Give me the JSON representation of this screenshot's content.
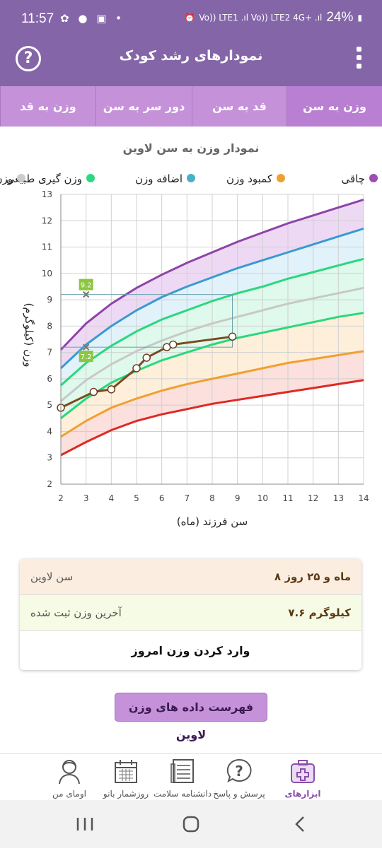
{
  "status": {
    "time": "11:57",
    "left_icons": "✿ ● ▣ •",
    "network": "Vo)) LTE1 .ıl Vo)) LTE2 4G+ .ıl",
    "battery": "24%"
  },
  "app_bar": {
    "title": "نمودارهای رشد کودک",
    "help_icon": "?"
  },
  "tabs": [
    "وزن به سن",
    "قد به سن",
    "دور سر به سن",
    "وزن به قد"
  ],
  "chart_data": {
    "type": "line",
    "title": "نمودار وزن به سن لاوین",
    "xlabel": "سن فرزند (ماه)",
    "ylabel": "وزن (کیلوگرم)",
    "xlim": [
      2,
      14
    ],
    "ylim": [
      2,
      13
    ],
    "x_ticks": [
      2,
      3,
      4,
      5,
      6,
      7,
      8,
      9,
      10,
      11,
      12,
      13,
      14
    ],
    "y_ticks": [
      2,
      3,
      4,
      5,
      6,
      7,
      8,
      9,
      10,
      11,
      12,
      13
    ],
    "legend": [
      "چاقی",
      "کمبود وزن",
      "اضافه وزن",
      "وزن گیری طبیعی",
      "وزن میانگین"
    ],
    "legend_colors": [
      "#9c4fb0",
      "#f0a030",
      "#4ab0c8",
      "#2ed880",
      "#cccccc"
    ],
    "curves": [
      {
        "color": "#8e44a8",
        "x": [
          2,
          3,
          4,
          5,
          6,
          7,
          8,
          9,
          10,
          11,
          12,
          13,
          14
        ],
        "y": [
          7.1,
          8.1,
          8.85,
          9.45,
          9.95,
          10.4,
          10.8,
          11.2,
          11.55,
          11.9,
          12.2,
          12.5,
          12.8
        ]
      },
      {
        "color": "#3a9ad0",
        "x": [
          2,
          3,
          4,
          5,
          6,
          7,
          8,
          9,
          10,
          11,
          12,
          13,
          14
        ],
        "y": [
          6.4,
          7.3,
          8.0,
          8.6,
          9.1,
          9.5,
          9.85,
          10.2,
          10.5,
          10.8,
          11.1,
          11.4,
          11.7
        ]
      },
      {
        "color": "#2ad87c",
        "x": [
          2,
          3,
          4,
          5,
          6,
          7,
          8,
          9,
          10,
          11,
          12,
          13,
          14
        ],
        "y": [
          5.75,
          6.6,
          7.25,
          7.8,
          8.25,
          8.6,
          8.95,
          9.25,
          9.5,
          9.8,
          10.05,
          10.3,
          10.55
        ]
      },
      {
        "color": "#c8c8c8",
        "x": [
          2,
          3,
          4,
          5,
          6,
          7,
          8,
          9,
          10,
          11,
          12,
          13,
          14
        ],
        "y": [
          5.15,
          5.95,
          6.55,
          7.05,
          7.45,
          7.8,
          8.1,
          8.35,
          8.6,
          8.85,
          9.05,
          9.25,
          9.45
        ]
      },
      {
        "color": "#2ad87c",
        "x": [
          2,
          3,
          4,
          5,
          6,
          7,
          8,
          9,
          10,
          11,
          12,
          13,
          14
        ],
        "y": [
          4.5,
          5.25,
          5.85,
          6.3,
          6.7,
          7.0,
          7.3,
          7.55,
          7.75,
          7.95,
          8.15,
          8.35,
          8.5
        ]
      },
      {
        "color": "#f0a030",
        "x": [
          2,
          3,
          4,
          5,
          6,
          7,
          8,
          9,
          10,
          11,
          12,
          13,
          14
        ],
        "y": [
          3.8,
          4.4,
          4.9,
          5.25,
          5.55,
          5.8,
          6.0,
          6.2,
          6.4,
          6.6,
          6.75,
          6.9,
          7.05
        ]
      },
      {
        "color": "#dd2a24",
        "x": [
          2,
          3,
          4,
          5,
          6,
          7,
          8,
          9,
          10,
          11,
          12,
          13,
          14
        ],
        "y": [
          3.1,
          3.6,
          4.05,
          4.4,
          4.65,
          4.85,
          5.05,
          5.2,
          5.35,
          5.5,
          5.65,
          5.8,
          5.95
        ]
      }
    ],
    "bands": [
      {
        "color": "#e8ccf0",
        "upper": 0,
        "lower": 1
      },
      {
        "color": "#d7eef8",
        "upper": 1,
        "lower": 2
      },
      {
        "color": "#d4f7e5",
        "upper": 2,
        "lower": 4
      },
      {
        "color": "#fde9cf",
        "upper": 4,
        "lower": 5
      },
      {
        "color": "#fad6d2",
        "upper": 5,
        "lower": 6
      }
    ],
    "series": [
      {
        "color": "#7a4a1e",
        "x": [
          2.0,
          3.3,
          4.0,
          5.0,
          5.4,
          6.2,
          6.45,
          8.8
        ],
        "y": [
          4.9,
          5.5,
          5.6,
          6.4,
          6.8,
          7.2,
          7.3,
          7.6
        ]
      }
    ],
    "markers": [
      {
        "x": 3,
        "y": 9.2,
        "label": "9.2"
      },
      {
        "x": 3,
        "y": 7.2,
        "label": "7.2"
      }
    ],
    "highlight_box": {
      "x0": 2,
      "x1": 8.8,
      "y0": 7.2,
      "y1": 9.2
    }
  },
  "info": {
    "age_label": "سن لاوین",
    "age_value": "۸ ماه و ۲۵ روز",
    "weight_label": "آخرین وزن ثبت شده",
    "weight_value": "۷.۶ کیلوگرم",
    "enter_label": "وارد کردن وزن امروز"
  },
  "list_button": "فهرست داده های وزن لاوین",
  "bottom_nav": [
    {
      "label": "ابزارهای سلامت",
      "icon": "health-kit-icon",
      "active": true
    },
    {
      "label": "پرسش و پاسخ",
      "icon": "question-bubble-icon",
      "active": false
    },
    {
      "label": "دانشنامه سلامت",
      "icon": "encyclopedia-icon",
      "active": false
    },
    {
      "label": "روزشمار بانو",
      "icon": "calendar-icon",
      "active": false
    },
    {
      "label": "اومای من",
      "icon": "profile-icon",
      "active": false
    }
  ]
}
